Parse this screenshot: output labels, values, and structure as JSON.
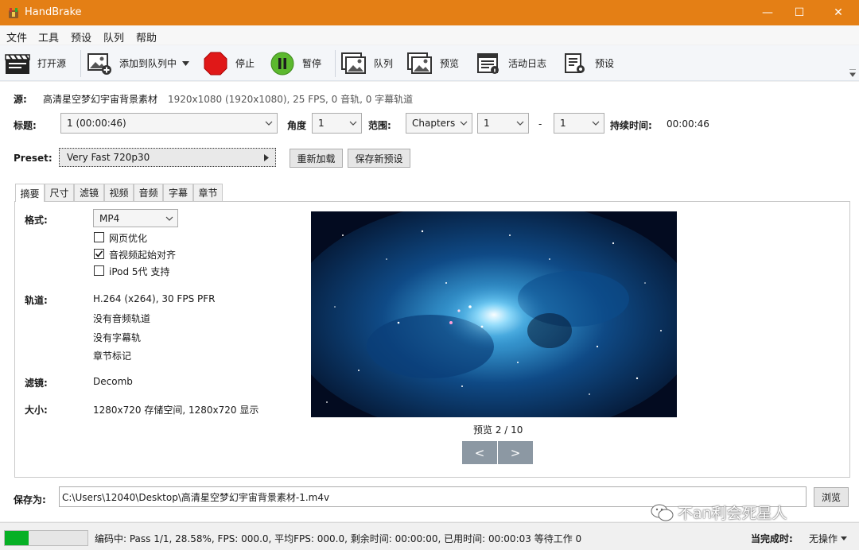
{
  "window": {
    "title": "HandBrake",
    "minimize": "—",
    "maximize": "☐",
    "close": "✕"
  },
  "menu": [
    "文件",
    "工具",
    "预设",
    "队列",
    "帮助"
  ],
  "toolbar": {
    "open_source": "打开源",
    "add_to_queue": "添加到队列中",
    "stop": "停止",
    "pause": "暂停",
    "queue": "队列",
    "preview": "预览",
    "activity_log": "活动日志",
    "presets": "预设"
  },
  "source": {
    "label": "源:",
    "name": "高清星空梦幻宇宙背景素材",
    "info": "1920x1080 (1920x1080), 25 FPS, 0 音轨, 0 字幕轨道"
  },
  "title_row": {
    "title_label": "标题:",
    "title_value": "1  (00:00:46)",
    "angle_label": "角度",
    "angle_value": "1",
    "range_label": "范围:",
    "range_type": "Chapters",
    "range_start": "1",
    "range_dash": "-",
    "range_end": "1",
    "duration_label": "持续时间:",
    "duration_value": "00:00:46"
  },
  "preset": {
    "label": "Preset:",
    "value": "Very Fast 720p30",
    "reload_button": "重新加载",
    "save_new_button": "保存新预设"
  },
  "tabs": [
    "摘要",
    "尺寸",
    "滤镜",
    "视频",
    "音频",
    "字幕",
    "章节"
  ],
  "summary": {
    "format_label": "格式:",
    "format_value": "MP4",
    "web_optimized": {
      "label": "网页优化",
      "checked": false
    },
    "align_av": {
      "label": "音视频起始对齐",
      "checked": true
    },
    "ipod": {
      "label": "iPod 5代 支持",
      "checked": false
    },
    "tracks_label": "轨道:",
    "tracks": [
      "H.264 (x264), 30 FPS PFR",
      "没有音频轨道",
      "没有字幕轨",
      "章节标记"
    ],
    "filters_label": "滤镜:",
    "filters_value": "Decomb",
    "size_label": "大小:",
    "size_value": "1280x720 存储空间, 1280x720 显示",
    "preview_label": "预览 2 / 10",
    "prev_button": "<",
    "next_button": ">"
  },
  "save": {
    "label": "保存为:",
    "path": "C:\\Users\\12040\\Desktop\\高清星空梦幻宇宙背景素材-1.m4v",
    "browse_button": "浏览"
  },
  "watermark": "不an利会死星人",
  "status": {
    "progress": 0.2858,
    "text": "编码中: Pass 1/1,  28.58%, FPS: 000.0, 平均FPS: 000.0, 剩余时间:  00:00:00, 已用时间:  00:00:03   等待工作 0",
    "when_done_label": "当完成时:",
    "when_done_value": "无操作"
  },
  "colors": {
    "titlebar": "#e47f15",
    "progress": "#06b025",
    "stop": "#e01818",
    "pause": "#5cb82e"
  }
}
